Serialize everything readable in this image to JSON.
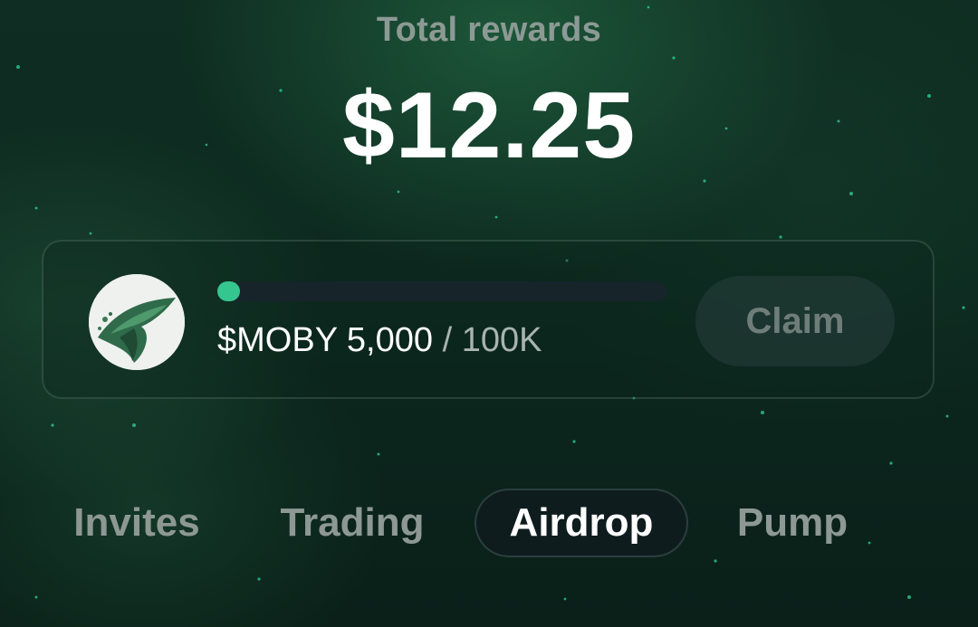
{
  "header": {
    "title": "Total rewards",
    "amount": "$12.25"
  },
  "reward_card": {
    "token_icon": "moby-whale-avatar",
    "progress_fraction": 0.05,
    "token": "$MOBY",
    "current": "5,000",
    "separator": "/",
    "max": "100K",
    "claim_label": "Claim"
  },
  "tabs": [
    {
      "label": "Invites",
      "active": false
    },
    {
      "label": "Trading",
      "active": false
    },
    {
      "label": "Airdrop",
      "active": true
    },
    {
      "label": "Pump",
      "active": false
    }
  ],
  "colors": {
    "accent": "#35c58e",
    "background": "#0d2a20"
  }
}
